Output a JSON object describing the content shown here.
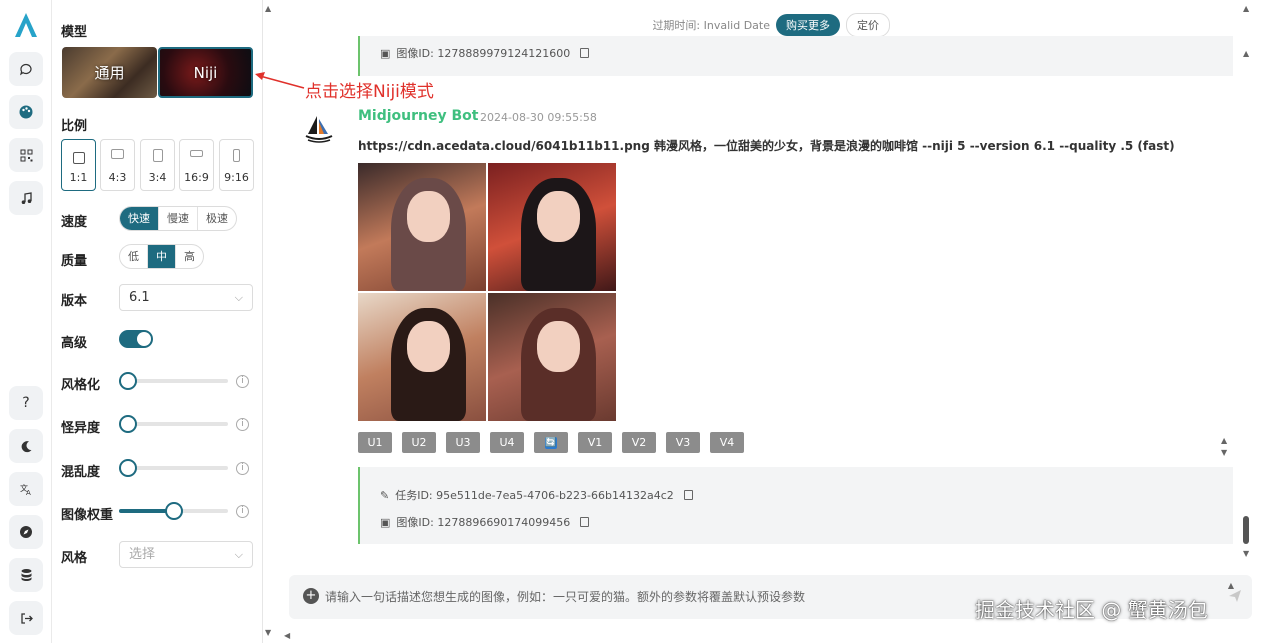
{
  "rail": {
    "items": [
      "chat-icon",
      "palette-icon",
      "qrcode-icon",
      "music-icon",
      "help-icon",
      "moon-icon",
      "translate-icon",
      "compass-icon",
      "database-icon",
      "logout-icon"
    ],
    "help_glyph": "?"
  },
  "panel": {
    "model_label": "模型",
    "models": [
      {
        "label": "通用"
      },
      {
        "label": "Niji"
      }
    ],
    "ratio_label": "比例",
    "ratios": [
      "1:1",
      "4:3",
      "3:4",
      "16:9",
      "9:16"
    ],
    "speed_label": "速度",
    "speeds": [
      "快速",
      "慢速",
      "极速"
    ],
    "quality_label": "质量",
    "qualities": [
      "低",
      "中",
      "高"
    ],
    "version_label": "版本",
    "version_value": "6.1",
    "advanced_label": "高级",
    "advanced_on": true,
    "stylize_label": "风格化",
    "stylize_level": 0.08,
    "weird_label": "怪异度",
    "weird_level": 0.0,
    "chaos_label": "混乱度",
    "chaos_level": 0.0,
    "iw_label": "图像权重",
    "iw_level": 0.5,
    "style_label": "风格",
    "style_placeholder": "选择"
  },
  "annotation": {
    "text": "点击选择Niji模式",
    "color": "#e0312b"
  },
  "topbar": {
    "expire_text": "过期时间: Invalid Date",
    "buy_label": "购买更多",
    "price_label": "定价"
  },
  "messages": {
    "prev_image_id": "图像ID: 1278889979124121600",
    "bot_name": "Midjourney Bot",
    "bot_time": "2024-08-30 09:55:58",
    "prompt": "https://cdn.acedata.cloud/6041b11b11.png 韩漫风格，一位甜美的少女，背景是浪漫的咖啡馆 --niji 5 --version 6.1 --quality .5 (fast)",
    "actions": [
      "U1",
      "U2",
      "U3",
      "U4",
      "🔄",
      "V1",
      "V2",
      "V3",
      "V4"
    ],
    "task_id": "任务ID: 95e511de-7ea5-4706-b223-66b14132a4c2",
    "image_id": "图像ID: 1278896690174099456"
  },
  "input": {
    "placeholder": "请输入一句话描述您想生成的图像，例如：一只可爱的猫。额外的参数将覆盖默认预设参数"
  },
  "watermark": "掘金技术社区 @ 蟹黄汤包",
  "colors": {
    "accent": "#1e6b80",
    "bot_name": "#3fbf7f",
    "annotation": "#e0312b"
  }
}
